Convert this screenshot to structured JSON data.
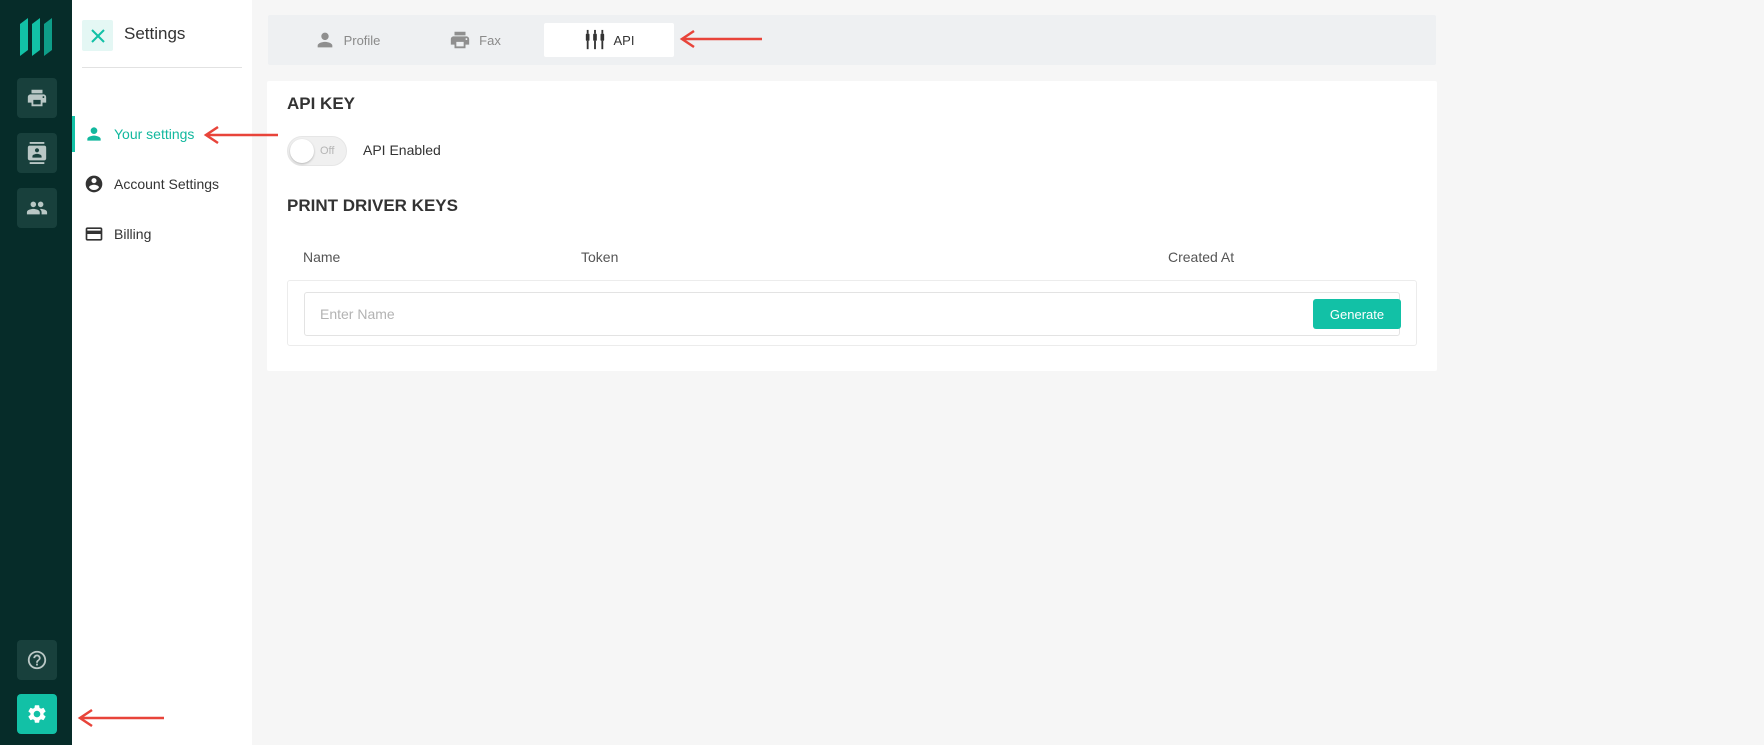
{
  "rail": {
    "logo_icon": "brand-logo-icon",
    "items": [
      {
        "icon": "printer-icon"
      },
      {
        "icon": "contacts-icon"
      },
      {
        "icon": "people-icon"
      }
    ],
    "bottom_items": [
      {
        "icon": "help-icon"
      },
      {
        "icon": "gear-icon",
        "active": true
      }
    ]
  },
  "settings_panel": {
    "title": "Settings",
    "close_icon": "close-icon",
    "nav": [
      {
        "label": "Your settings",
        "icon": "person-icon",
        "active": true
      },
      {
        "label": "Account Settings",
        "icon": "account-circle-icon"
      },
      {
        "label": "Billing",
        "icon": "credit-card-icon"
      }
    ]
  },
  "tabs": [
    {
      "label": "Profile",
      "icon": "person-icon"
    },
    {
      "label": "Fax",
      "icon": "printer-icon"
    },
    {
      "label": "API",
      "icon": "api-plug-icon",
      "active": true
    }
  ],
  "api_key": {
    "heading": "API KEY",
    "toggle_state": "Off",
    "toggle_label": "API Enabled"
  },
  "print_driver_keys": {
    "heading": "PRINT DRIVER KEYS",
    "columns": [
      "Name",
      "Token",
      "Created At"
    ],
    "name_placeholder": "Enter Name",
    "generate_label": "Generate"
  },
  "colors": {
    "accent": "#12c1a6",
    "rail_bg": "#062c29",
    "annotation": "#e8443a"
  }
}
